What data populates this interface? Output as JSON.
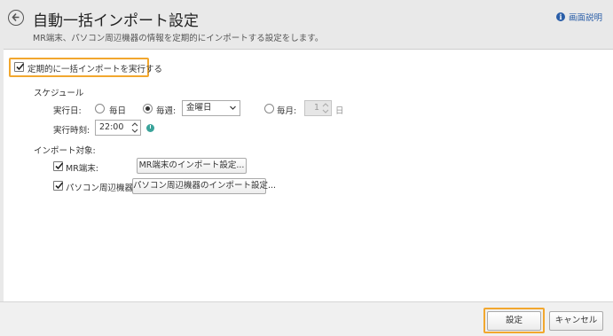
{
  "header": {
    "title": "自動一括インポート設定",
    "subtitle": "MR端末、パソコン周辺機器の情報を定期的にインポートする設定をします。",
    "help_label": "画面説明"
  },
  "enable": {
    "label": "定期的に一括インポートを実行する",
    "checked": true
  },
  "schedule": {
    "section_label": "スケジュール",
    "run_day_label": "実行日:",
    "daily_label": "毎日",
    "weekly_label": "毎週:",
    "weekly_day": "金曜日",
    "monthly_label": "毎月:",
    "monthly_day": "1",
    "monthly_unit": "日",
    "selected": "weekly",
    "run_time_label": "実行時刻:",
    "run_time": "22:00"
  },
  "targets": {
    "section_label": "インポート対象:",
    "mr": {
      "label": "MR端末:",
      "checked": true,
      "button": "MR端末のインポート設定..."
    },
    "pc": {
      "label": "パソコン周辺機器:",
      "checked": true,
      "button": "パソコン周辺機器のインポート設定..."
    }
  },
  "footer": {
    "ok": "設定",
    "cancel": "キャンセル"
  },
  "colors": {
    "highlight": "#f2a72e",
    "link": "#2a5ea8",
    "clock": "#3aa39a"
  }
}
